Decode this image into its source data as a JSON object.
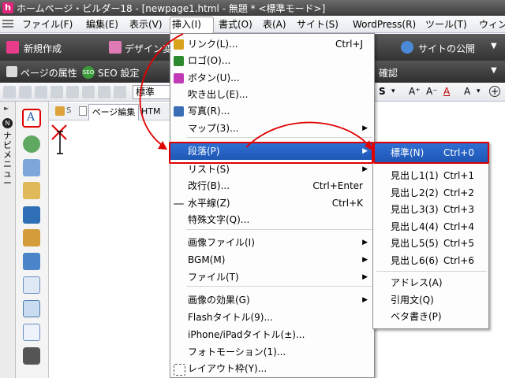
{
  "window": {
    "app_icon": "h",
    "title": "ホームページ・ビルダー18 - [newpage1.html - 無題 * <標準モード>]"
  },
  "menubar": {
    "items": [
      "ファイル(F)",
      "編集(E)",
      "表示(V)",
      "挿入(I)",
      "書式(O)",
      "表(A)",
      "サイト(S)",
      "WordPress(R)",
      "ツール(T)",
      "ウィン"
    ]
  },
  "toolbar1": {
    "new": "新規作成",
    "design": "デザイン変更",
    "site_publish": "サイトの公開"
  },
  "toolbar2": {
    "page_props": "ページの属性",
    "seo": "SEO 設定",
    "confirm": "確認"
  },
  "toolbar3": {
    "style_select": "標準"
  },
  "nav_panel_label": "ナビメニュー",
  "tabs": {
    "page_edit": "ページ編集",
    "html": "HTM"
  },
  "insert_menu": {
    "items": [
      {
        "label": "リンク(L)...",
        "shortcut": "Ctrl+J",
        "icon": "link-icon",
        "color": "#d9a21b"
      },
      {
        "label": "ロゴ(O)...",
        "shortcut": "",
        "icon": "logo-icon",
        "color": "#2c8a2c"
      },
      {
        "label": "ボタン(U)...",
        "shortcut": "",
        "icon": "button-icon",
        "color": "#c03ab8"
      },
      {
        "label": "吹き出し(E)...",
        "shortcut": "",
        "icon": "",
        "color": ""
      },
      {
        "label": "写真(R)...",
        "shortcut": "",
        "icon": "photo-icon",
        "color": "#3b6fb5"
      },
      {
        "label": "マップ(3)...",
        "shortcut": "",
        "icon": "",
        "color": "",
        "submenu": true
      },
      {
        "label": "段落(P)",
        "shortcut": "",
        "icon": "",
        "color": "",
        "submenu": true,
        "highlighted": true
      },
      {
        "label": "リスト(S)",
        "shortcut": "",
        "icon": "",
        "color": "",
        "submenu": true
      },
      {
        "label": "改行(B)...",
        "shortcut": "Ctrl+Enter",
        "icon": "",
        "color": ""
      },
      {
        "label": "水平線(Z)",
        "shortcut": "Ctrl+K",
        "icon": "hr-icon",
        "color": "#888888"
      },
      {
        "label": "特殊文字(Q)...",
        "shortcut": "",
        "icon": "",
        "color": ""
      },
      {
        "label": "画像ファイル(I)",
        "shortcut": "",
        "icon": "",
        "color": "",
        "submenu": true
      },
      {
        "label": "BGM(M)",
        "shortcut": "",
        "icon": "",
        "color": "",
        "submenu": true
      },
      {
        "label": "ファイル(T)",
        "shortcut": "",
        "icon": "",
        "color": "",
        "submenu": true
      },
      {
        "label": "画像の効果(G)",
        "shortcut": "",
        "icon": "",
        "color": "",
        "submenu": true
      },
      {
        "label": "Flashタイトル(9)...",
        "shortcut": "",
        "icon": "",
        "color": ""
      },
      {
        "label": "iPhone/iPadタイトル(±)...",
        "shortcut": "",
        "icon": "",
        "color": ""
      },
      {
        "label": "フォトモーション(1)...",
        "shortcut": "",
        "icon": "",
        "color": ""
      },
      {
        "label": "レイアウト枠(Y)...",
        "shortcut": "",
        "icon": "layout-frame-icon",
        "color": "#555555"
      }
    ]
  },
  "paragraph_submenu": {
    "items": [
      {
        "label": "標準(N)",
        "shortcut": "Ctrl+0",
        "highlighted": true
      },
      {
        "label": "見出し1(1)",
        "shortcut": "Ctrl+1"
      },
      {
        "label": "見出し2(2)",
        "shortcut": "Ctrl+2"
      },
      {
        "label": "見出し3(3)",
        "shortcut": "Ctrl+3"
      },
      {
        "label": "見出し4(4)",
        "shortcut": "Ctrl+4"
      },
      {
        "label": "見出し5(5)",
        "shortcut": "Ctrl+5"
      },
      {
        "label": "見出し6(6)",
        "shortcut": "Ctrl+6"
      },
      {
        "label": "アドレス(A)",
        "shortcut": ""
      },
      {
        "label": "引用文(Q)",
        "shortcut": ""
      },
      {
        "label": "ベタ書き(P)",
        "shortcut": ""
      }
    ]
  },
  "colors": {
    "highlight": "#1e57b4",
    "annotation_red": "#e00000",
    "menu_bar": "#e6e9ee",
    "dark_toolbar": "#3d3d3d"
  }
}
